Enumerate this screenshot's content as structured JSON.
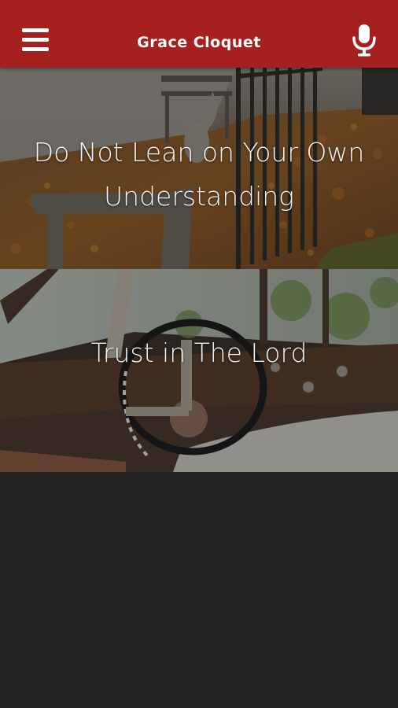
{
  "app": {
    "title": "Grace Cloquet",
    "menu_icon": "hamburger-menu-icon",
    "mic_icon": "microphone-icon",
    "accent_color": "#a5201e",
    "background_color": "#242424"
  },
  "cards": [
    {
      "title": "Do Not Lean on Your Own Understanding",
      "image": "squirrel-on-park-bench-autumn-leaves"
    },
    {
      "title": "Trust in The Lord",
      "image": "abandoned-rusty-car-interior-steering-wheel"
    }
  ]
}
